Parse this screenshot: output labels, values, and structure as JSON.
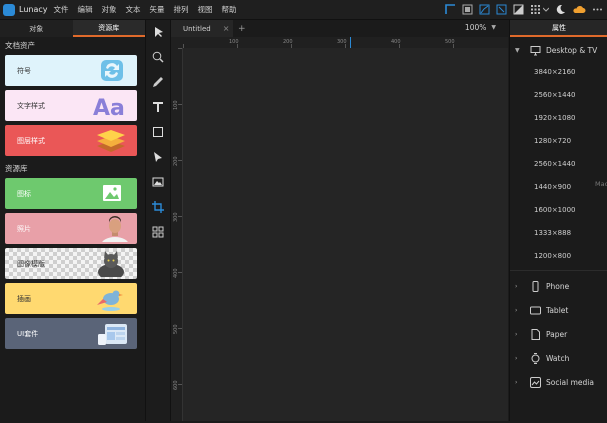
{
  "app": {
    "name": "Lunacy"
  },
  "menu": [
    "文件",
    "编辑",
    "对象",
    "文本",
    "矢量",
    "排列",
    "视图",
    "帮助"
  ],
  "left_panel": {
    "tabs": [
      "对象",
      "资源库"
    ],
    "section_assets": "文档资产",
    "section_library": "资源库",
    "asset_cards": [
      {
        "label": "符号",
        "color": "#dff3fb"
      },
      {
        "label": "文字样式",
        "color": "#fbe6f5"
      },
      {
        "label": "图层样式",
        "color": "#ea5757"
      }
    ],
    "library_cards": [
      {
        "label": "图标",
        "color": "#6ec96e"
      },
      {
        "label": "照片",
        "color": "#e8a0a8"
      },
      {
        "label": "图像模版",
        "color": "#ffffff"
      },
      {
        "label": "插画",
        "color": "#ffd970"
      },
      {
        "label": "UI套件",
        "color": "#5a6478"
      }
    ]
  },
  "document": {
    "tab_title": "Untitled",
    "close_symbol": "×",
    "add_symbol": "+",
    "zoom": "100%"
  },
  "ruler": {
    "top_labels": [
      "100",
      "200",
      "300",
      "400",
      "500"
    ],
    "left_labels": [
      "100",
      "200",
      "300",
      "400",
      "500",
      "600"
    ]
  },
  "right_panel": {
    "tab": "属性",
    "expanded_group": "Desktop & TV",
    "presets": [
      "3840×2160",
      "2560×1440",
      "1920×1080",
      "1280×720",
      "2560×1440",
      "1440×900",
      "1600×1000",
      "1333×888",
      "1200×800"
    ],
    "side_hint": "Mac",
    "groups": [
      {
        "label": "Phone",
        "icon": "phone-icon"
      },
      {
        "label": "Tablet",
        "icon": "tablet-icon"
      },
      {
        "label": "Paper",
        "icon": "paper-icon"
      },
      {
        "label": "Watch",
        "icon": "watch-icon"
      },
      {
        "label": "Social media",
        "icon": "social-media-icon"
      }
    ]
  },
  "colors": {
    "accent": "#e06a2b",
    "selected_tool": "#2b8ad6"
  }
}
